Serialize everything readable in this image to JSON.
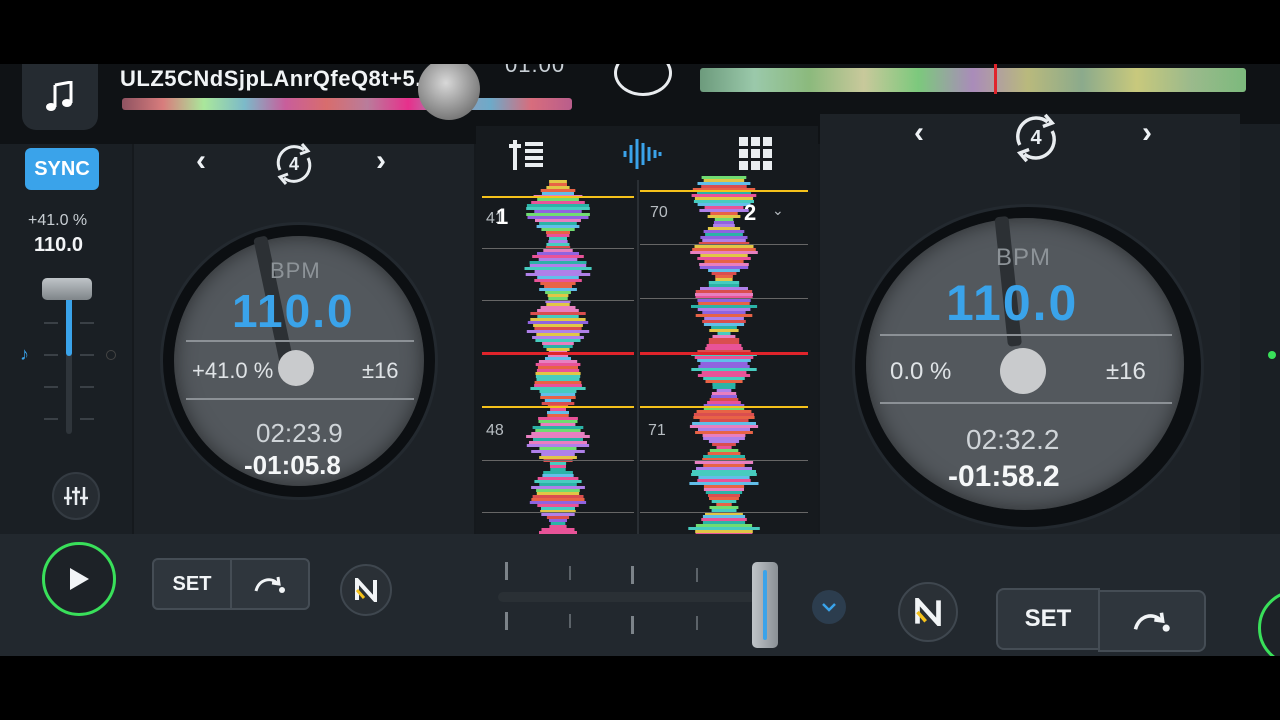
{
  "header": {
    "track_title": "ULZ5CNdSjpLAnrQfeQ8t+5...",
    "time_partial": "01:00",
    "music_icon": "music-note-icon"
  },
  "left_panel": {
    "sync_label": "SYNC",
    "pitch_percent": "+41.0 %",
    "pitch_bpm": "110.0",
    "pitch_fader_level": 0.56
  },
  "deck1": {
    "loop_beats": "4",
    "bpm_label": "BPM",
    "bpm_value": "110.0",
    "pitch_percent": "+41.0 %",
    "pitch_range": "±16",
    "elapsed": "02:23.9",
    "remaining": "-01:05.8"
  },
  "deck2": {
    "loop_beats": "4",
    "bpm_label": "BPM",
    "bpm_value": "110.0",
    "pitch_percent": "0.0 %",
    "pitch_range": "±16",
    "elapsed": "02:32.2",
    "remaining": "-01:58.2"
  },
  "center": {
    "wave1_marker_top": "41",
    "wave1_deck": "1",
    "wave1_marker_bottom": "48",
    "wave2_marker_top": "70",
    "wave2_deck": "2",
    "wave2_marker_bottom": "71"
  },
  "bottom": {
    "set_left": "SET",
    "set_right": "SET",
    "crossfader_position": 1.0
  },
  "colors": {
    "accent": "#3aa3ea",
    "play_ring": "#39e05a",
    "panel": "#1d2227",
    "background": "#15191d"
  }
}
